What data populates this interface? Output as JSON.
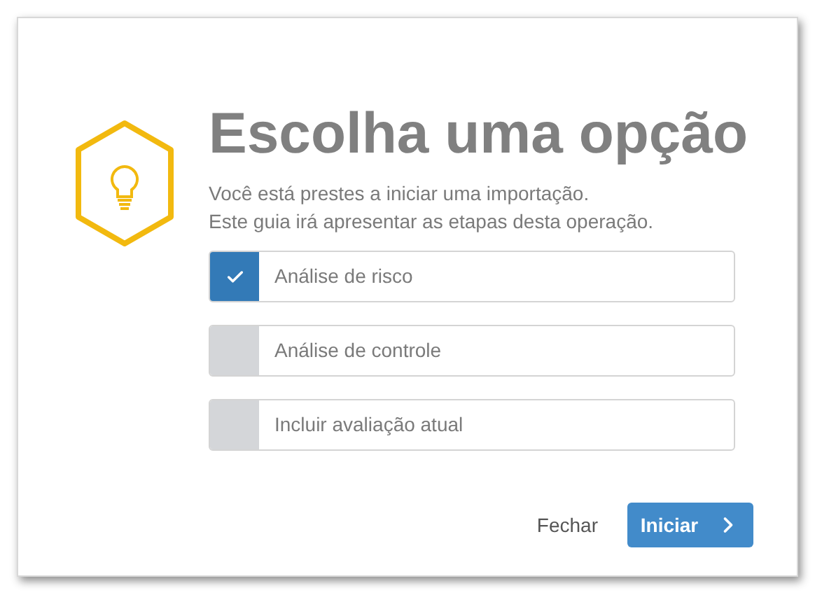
{
  "title": "Escolha uma opção",
  "description": [
    "Você está prestes a iniciar uma importação.",
    "Este guia irá apresentar as etapas desta operação."
  ],
  "options": [
    {
      "label": "Análise de risco",
      "checked": true
    },
    {
      "label": "Análise de controle",
      "checked": false
    },
    {
      "label": "Incluir avaliação atual",
      "checked": false
    }
  ],
  "buttons": {
    "close": "Fechar",
    "start": "Iniciar"
  }
}
